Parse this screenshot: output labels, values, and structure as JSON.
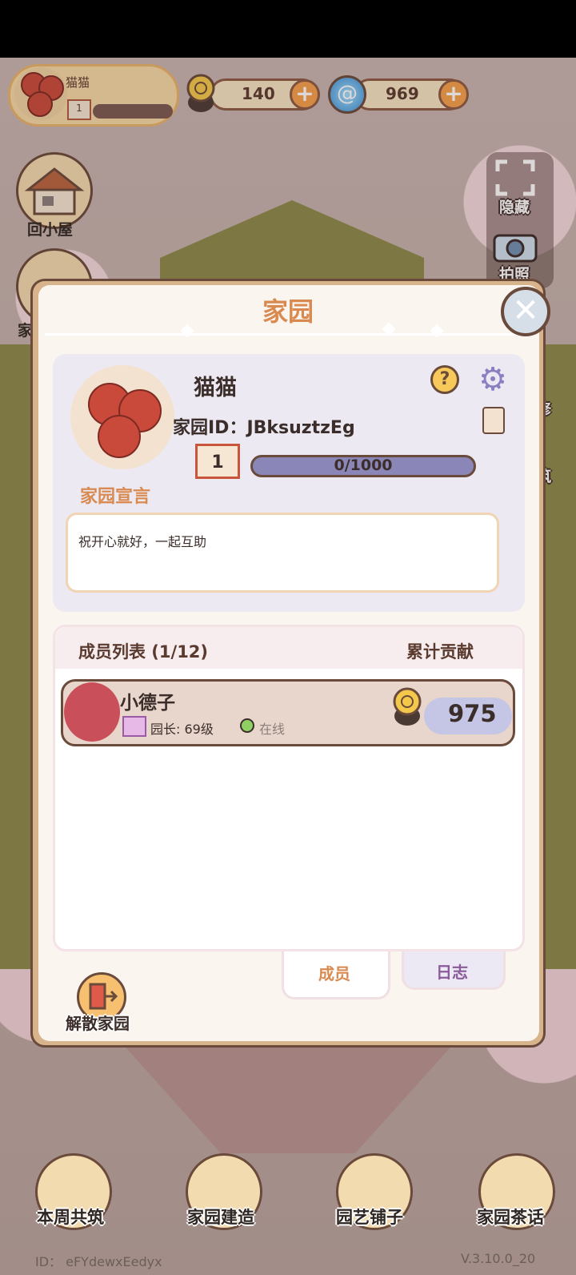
{
  "hud": {
    "player_name": "猫猫",
    "player_level": "1",
    "snail_currency": "140",
    "gem_currency": "969"
  },
  "side": {
    "home_label": "回小屋",
    "partial_label": "家",
    "hide_label": "隐藏",
    "photo_label": "拍照",
    "repair_partial": "修",
    "build_partial": "筑"
  },
  "modal": {
    "title": "家园",
    "garden_name": "猫猫",
    "garden_id": "家园ID：JBksuztzEg",
    "level": "1",
    "exp": "0/1000",
    "exp_fraction": 0.0,
    "declaration_label": "家园宣言",
    "declaration_text": "祝开心就好，一起互助",
    "member_list_title": "成员列表  (1/12)",
    "contribution_title": "累计贡献",
    "members": [
      {
        "name": "小德子",
        "role": "园长: 69级",
        "status": "在线",
        "contribution": "975"
      }
    ],
    "tabs": [
      {
        "label": "成员",
        "active": true
      },
      {
        "label": "日志",
        "active": false
      }
    ],
    "disband_label": "解散家园"
  },
  "bottom_nav": [
    {
      "label": "本周共筑"
    },
    {
      "label": "家园建造"
    },
    {
      "label": "园艺铺子"
    },
    {
      "label": "家园茶话"
    }
  ],
  "footer": {
    "id_text": "ID：  eFYdewxEedyx",
    "version": "V.3.10.0_20"
  },
  "colors": {
    "accent_orange": "#d98a50",
    "outline_brown": "#6a4a3a",
    "exp_purple": "#8a86b8",
    "online_green": "#8fd064"
  }
}
